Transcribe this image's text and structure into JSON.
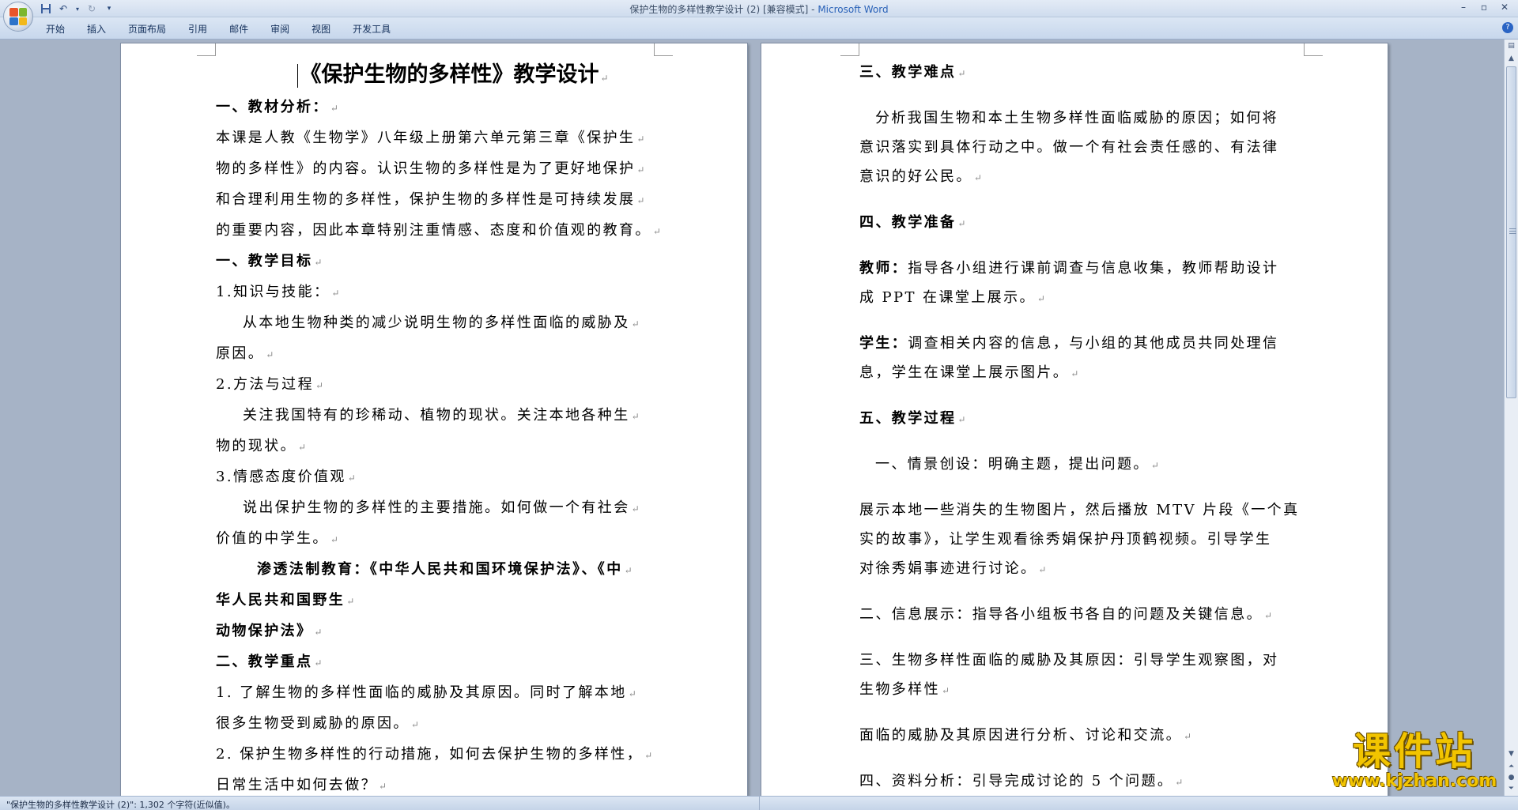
{
  "window": {
    "title_doc": "保护生物的多样性教学设计 (2) [兼容模式] - ",
    "title_app": "Microsoft Word",
    "controls": [
      "–",
      "▫",
      "✕"
    ]
  },
  "ribbon": {
    "tabs": [
      "开始",
      "插入",
      "页面布局",
      "引用",
      "邮件",
      "审阅",
      "视图",
      "开发工具"
    ],
    "help": "?"
  },
  "left_page": {
    "title": "《保护生物的多样性》教学设计",
    "paragraphs": [
      {
        "text": "一、教材分析：",
        "style": "b"
      },
      {
        "text": "本课是人教《生物学》八年级上册第六单元第三章《保护生",
        "style": ""
      },
      {
        "text": "物的多样性》的内容。认识生物的多样性是为了更好地保护",
        "style": ""
      },
      {
        "text": "和合理利用生物的多样性，保护生物的多样性是可持续发展",
        "style": ""
      },
      {
        "text": "的重要内容，因此本章特别注重情感、态度和价值观的教育。",
        "style": ""
      },
      {
        "text": "一、教学目标",
        "style": "b"
      },
      {
        "text": "1.知识与技能：",
        "style": ""
      },
      {
        "text": "从本地生物种类的减少说明生物的多样性面临的威胁及",
        "style": "indent"
      },
      {
        "text": "原因。",
        "style": ""
      },
      {
        "text": "2.方法与过程",
        "style": ""
      },
      {
        "text": "关注我国特有的珍稀动、植物的现状。关注本地各种生",
        "style": "indent"
      },
      {
        "text": "物的现状。",
        "style": ""
      },
      {
        "text": "3.情感态度价值观",
        "style": ""
      },
      {
        "text": "说出保护生物的多样性的主要措施。如何做一个有社会",
        "style": "indent"
      },
      {
        "text": "价值的中学生。",
        "style": ""
      },
      {
        "text": "渗透法制教育：《中华人民共和国环境保护法》、《中",
        "style": "b indent2"
      },
      {
        "text": "华人民共和国野生",
        "style": "b"
      },
      {
        "text": "动物保护法》",
        "style": "b"
      },
      {
        "text": "二、教学重点",
        "style": "b"
      },
      {
        "text": "1. 了解生物的多样性面临的威胁及其原因。同时了解本地",
        "style": ""
      },
      {
        "text": "很多生物受到威胁的原因。",
        "style": ""
      },
      {
        "text": "2. 保护生物多样性的行动措施，如何去保护生物的多样性，",
        "style": ""
      },
      {
        "text": "日常生活中如何去做？",
        "style": ""
      }
    ]
  },
  "right_page": {
    "h3": "三、教学难点",
    "difficulty": [
      "分析我国生物和本土生物多样性面临威胁的原因；如何将",
      "意识落实到具体行动之中。做一个有社会责任感的、有法律",
      "意识的好公民。"
    ],
    "h4": "四、教学准备",
    "teacher_label": "教师：",
    "teacher": [
      "指导各小组进行课前调查与信息收集，教师帮助设计",
      "成 PPT 在课堂上展示。"
    ],
    "student_label": "学生：",
    "student": [
      "调查相关内容的信息，与小组的其他成员共同处理信",
      "息，学生在课堂上展示图片。"
    ],
    "h5": "五、教学过程",
    "step1": "一、情景创设：明确主题，提出问题。",
    "step1_detail": [
      "展示本地一些消失的生物图片，然后播放 MTV 片段《一个真",
      "实的故事》，让学生观看徐秀娟保护丹顶鹤视频。引导学生",
      "对徐秀娟事迹进行讨论。"
    ],
    "step2": "二、信息展示：指导各小组板书各自的问题及关键信息。",
    "step3": [
      "三、生物多样性面临的威胁及其原因：引导学生观察图，对",
      "生物多样性"
    ],
    "step3_cont": "面临的威胁及其原因进行分析、讨论和交流。",
    "step4": "四、资料分析：引导完成讨论的 5 个问题。"
  },
  "statusbar": {
    "text": "\"保护生物的多样性教学设计 (2)\": 1,302 个字符(近似值)。"
  },
  "watermark": {
    "logo": "课件站",
    "url": "www.kjzhan.com"
  },
  "colors": {
    "workspace": "#a6b3c6",
    "watermark": "#f2c400",
    "title_app": "#2a62b8"
  }
}
